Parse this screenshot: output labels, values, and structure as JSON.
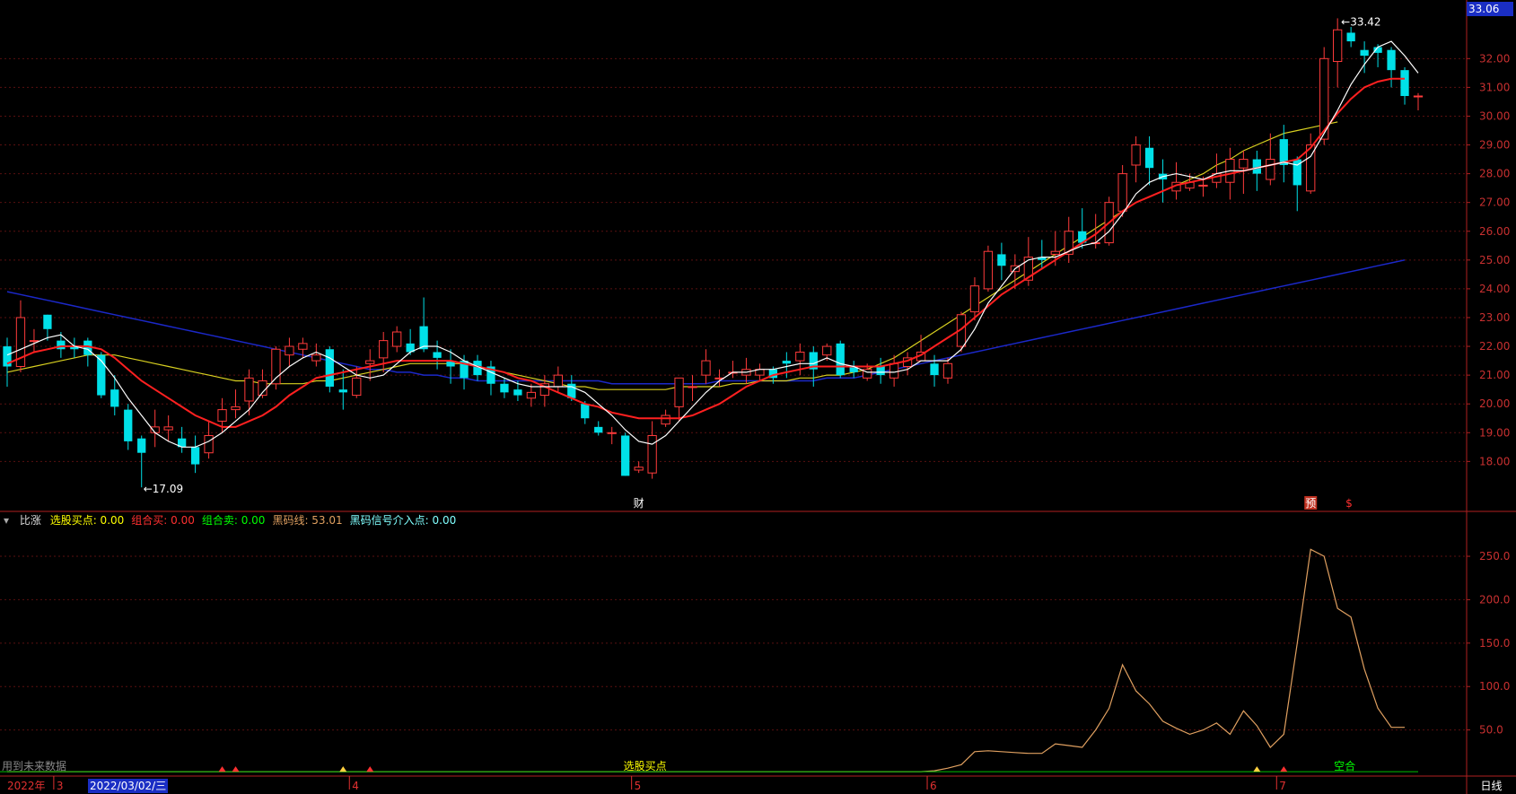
{
  "price_panel": {
    "current_price_tag": "33.06",
    "high_label": "33.42",
    "low_label": "17.09",
    "y_ticks": [
      "32.00",
      "31.00",
      "30.00",
      "29.00",
      "28.00",
      "27.00",
      "26.00",
      "25.00",
      "24.00",
      "23.00",
      "22.00",
      "21.00",
      "20.00",
      "19.00",
      "18.00"
    ],
    "event_labels": [
      {
        "text": "财",
        "color": "#ffffff"
      },
      {
        "text": "预",
        "color": "#ffffff",
        "bg": "#c03020"
      },
      {
        "text": "$",
        "color": "#ff3030"
      }
    ]
  },
  "indicator_panel": {
    "collapse_icon": "chevron-down-icon",
    "name": "比涨",
    "items": [
      {
        "label": "选股买点:",
        "value": "0.00",
        "color": "#ffff00"
      },
      {
        "label": "组合买:",
        "value": "0.00",
        "color": "#ff3030"
      },
      {
        "label": "组合卖:",
        "value": "0.00",
        "color": "#00ff00"
      },
      {
        "label": "黑码线:",
        "value": "53.01",
        "color": "#e0a060"
      },
      {
        "label": "黑码信号介入点:",
        "value": "0.00",
        "color": "#80ffff"
      }
    ],
    "y_ticks": [
      "250.0",
      "200.0",
      "150.0",
      "100.0",
      "50.0"
    ],
    "annotation_buy": "选股买点",
    "annotation_combo": "空合",
    "footer_note": "用到未来数据"
  },
  "date_axis": {
    "year": "2022年",
    "selected_date": "2022/03/02/三",
    "months": [
      "3",
      "4",
      "5",
      "6",
      "7"
    ],
    "period_button": "日线"
  },
  "colors": {
    "up": "#ff3b3b",
    "down": "#00e0e8",
    "ma5": "#ffffff",
    "ma10": "#ff2020",
    "ma20": "#d8d020",
    "ma60": "#1b28c8",
    "black_code_line": "#e0a060",
    "axis": "#b02020"
  },
  "chart_data": {
    "type": "candlestick",
    "y_range": [
      17.2,
      33.6
    ],
    "candles": [
      [
        22.0,
        21.3,
        22.3,
        20.6
      ],
      [
        21.3,
        23.0,
        23.6,
        21.1
      ],
      [
        22.2,
        22.2,
        22.6,
        21.8
      ],
      [
        23.1,
        22.6,
        23.1,
        22.2
      ],
      [
        22.2,
        21.9,
        22.5,
        21.6
      ],
      [
        22.0,
        21.9,
        22.3,
        21.6
      ],
      [
        22.2,
        21.7,
        22.3,
        21.3
      ],
      [
        21.7,
        20.3,
        21.8,
        20.2
      ],
      [
        20.5,
        19.9,
        21.0,
        19.6
      ],
      [
        19.8,
        18.7,
        20.0,
        18.4
      ],
      [
        18.8,
        18.3,
        18.9,
        17.1
      ],
      [
        19.0,
        19.2,
        19.8,
        18.5
      ],
      [
        19.1,
        19.2,
        19.6,
        18.7
      ],
      [
        18.8,
        18.5,
        19.2,
        18.3
      ],
      [
        18.5,
        17.9,
        18.9,
        17.6
      ],
      [
        18.3,
        18.9,
        19.4,
        18.1
      ],
      [
        19.4,
        19.8,
        20.2,
        19.0
      ],
      [
        19.8,
        19.9,
        20.5,
        19.5
      ],
      [
        20.1,
        20.9,
        21.2,
        19.6
      ],
      [
        20.3,
        20.8,
        21.2,
        20.2
      ],
      [
        20.7,
        21.9,
        22.0,
        20.5
      ],
      [
        21.7,
        22.0,
        22.3,
        21.3
      ],
      [
        21.9,
        22.1,
        22.3,
        21.6
      ],
      [
        21.5,
        21.7,
        22.1,
        21.3
      ],
      [
        21.9,
        20.6,
        22.0,
        20.4
      ],
      [
        20.5,
        20.4,
        21.2,
        19.8
      ],
      [
        20.3,
        20.9,
        21.3,
        20.2
      ],
      [
        21.4,
        21.5,
        21.9,
        20.8
      ],
      [
        21.6,
        22.2,
        22.5,
        21.1
      ],
      [
        22.0,
        22.5,
        22.7,
        21.8
      ],
      [
        22.1,
        21.8,
        22.6,
        21.7
      ],
      [
        22.7,
        21.9,
        23.7,
        21.8
      ],
      [
        21.8,
        21.6,
        22.2,
        21.2
      ],
      [
        21.5,
        21.3,
        21.9,
        20.7
      ],
      [
        21.5,
        20.9,
        21.7,
        20.5
      ],
      [
        21.5,
        21.0,
        21.7,
        20.8
      ],
      [
        21.3,
        20.7,
        21.5,
        20.3
      ],
      [
        20.7,
        20.4,
        20.9,
        20.2
      ],
      [
        20.5,
        20.3,
        20.8,
        20.1
      ],
      [
        20.2,
        20.4,
        20.7,
        19.9
      ],
      [
        20.3,
        20.7,
        21.0,
        19.9
      ],
      [
        20.6,
        21.0,
        21.3,
        20.4
      ],
      [
        20.7,
        20.2,
        21.0,
        20.1
      ],
      [
        20.0,
        19.5,
        20.1,
        19.3
      ],
      [
        19.2,
        19.0,
        19.4,
        18.9
      ],
      [
        19.0,
        19.0,
        19.2,
        18.6
      ],
      [
        18.9,
        17.5,
        19.0,
        17.5
      ],
      [
        17.7,
        17.8,
        18.0,
        17.6
      ],
      [
        17.6,
        18.9,
        19.4,
        17.4
      ],
      [
        19.3,
        19.6,
        19.8,
        19.2
      ],
      [
        19.9,
        20.9,
        20.9,
        19.4
      ],
      [
        20.6,
        20.6,
        21.0,
        20.1
      ],
      [
        21.0,
        21.5,
        21.9,
        20.7
      ],
      [
        20.9,
        20.9,
        21.2,
        20.6
      ],
      [
        21.1,
        21.1,
        21.5,
        20.9
      ],
      [
        21.0,
        21.2,
        21.6,
        20.7
      ],
      [
        21.0,
        21.2,
        21.4,
        20.8
      ],
      [
        21.2,
        20.9,
        21.3,
        20.7
      ],
      [
        21.5,
        21.4,
        21.8,
        20.9
      ],
      [
        21.5,
        21.8,
        22.1,
        21.0
      ],
      [
        21.8,
        21.2,
        22.0,
        20.6
      ],
      [
        21.7,
        22.0,
        22.1,
        21.5
      ],
      [
        22.1,
        21.0,
        22.2,
        20.9
      ],
      [
        21.3,
        21.1,
        21.5,
        20.9
      ],
      [
        20.9,
        21.2,
        21.4,
        20.8
      ],
      [
        21.3,
        21.0,
        21.6,
        20.7
      ],
      [
        20.9,
        21.4,
        21.7,
        20.6
      ],
      [
        21.3,
        21.6,
        21.8,
        21.0
      ],
      [
        21.5,
        21.8,
        22.4,
        21.5
      ],
      [
        21.4,
        21.0,
        21.7,
        20.6
      ],
      [
        20.9,
        21.4,
        21.6,
        20.7
      ],
      [
        22.0,
        23.1,
        23.2,
        21.8
      ],
      [
        23.2,
        24.1,
        24.4,
        22.9
      ],
      [
        24.0,
        25.3,
        25.5,
        23.9
      ],
      [
        25.2,
        24.8,
        25.6,
        24.3
      ],
      [
        24.6,
        24.8,
        25.2,
        24.0
      ],
      [
        24.3,
        25.1,
        25.8,
        24.1
      ],
      [
        25.1,
        25.0,
        25.7,
        24.7
      ],
      [
        25.2,
        25.3,
        26.0,
        24.8
      ],
      [
        25.2,
        26.0,
        26.5,
        24.9
      ],
      [
        26.0,
        25.6,
        26.8,
        25.4
      ],
      [
        25.6,
        25.6,
        26.6,
        25.4
      ],
      [
        25.6,
        27.0,
        27.2,
        25.5
      ],
      [
        26.7,
        28.0,
        28.3,
        26.5
      ],
      [
        28.3,
        29.0,
        29.3,
        27.7
      ],
      [
        28.9,
        28.2,
        29.3,
        27.6
      ],
      [
        28.0,
        27.8,
        28.5,
        27.0
      ],
      [
        27.4,
        27.7,
        28.4,
        27.1
      ],
      [
        27.5,
        27.7,
        28.0,
        27.4
      ],
      [
        27.6,
        27.6,
        27.9,
        27.2
      ],
      [
        27.7,
        28.0,
        28.7,
        27.5
      ],
      [
        27.7,
        28.5,
        28.9,
        27.1
      ],
      [
        28.2,
        28.5,
        28.8,
        27.3
      ],
      [
        28.5,
        28.0,
        28.8,
        27.4
      ],
      [
        27.8,
        28.5,
        29.4,
        27.6
      ],
      [
        29.2,
        28.3,
        29.7,
        27.7
      ],
      [
        28.5,
        27.6,
        28.6,
        26.7
      ],
      [
        27.4,
        29.0,
        29.4,
        27.3
      ],
      [
        29.2,
        32.0,
        32.4,
        29.0
      ],
      [
        31.9,
        33.0,
        33.4,
        31.0
      ],
      [
        32.9,
        32.6,
        33.1,
        32.4
      ],
      [
        32.3,
        32.1,
        32.6,
        31.5
      ],
      [
        32.4,
        32.2,
        32.5,
        31.7
      ],
      [
        32.3,
        31.6,
        32.4,
        31.0
      ],
      [
        31.6,
        30.7,
        31.7,
        30.4
      ],
      [
        30.7,
        30.7,
        30.8,
        30.2
      ]
    ],
    "ma5": [
      21.7,
      21.9,
      22.1,
      22.3,
      22.4,
      22.0,
      21.9,
      21.5,
      20.9,
      20.2,
      19.6,
      19.0,
      18.7,
      18.5,
      18.5,
      18.7,
      19.0,
      19.4,
      19.8,
      20.4,
      20.9,
      21.3,
      21.6,
      21.8,
      21.6,
      21.3,
      21.0,
      20.9,
      21.0,
      21.4,
      21.8,
      22.0,
      22.0,
      21.8,
      21.5,
      21.3,
      21.1,
      20.9,
      20.7,
      20.6,
      20.6,
      20.6,
      20.6,
      20.4,
      20.0,
      19.6,
      19.1,
      18.7,
      18.6,
      18.9,
      19.4,
      19.9,
      20.4,
      20.8,
      21.1,
      21.1,
      21.2,
      21.2,
      21.3,
      21.4,
      21.4,
      21.6,
      21.4,
      21.3,
      21.1,
      21.1,
      21.1,
      21.2,
      21.5,
      21.5,
      21.5,
      21.9,
      22.6,
      23.5,
      24.1,
      24.7,
      25.0,
      25.1,
      25.1,
      25.3,
      25.5,
      25.6,
      26.0,
      26.6,
      27.3,
      27.7,
      27.9,
      28.0,
      27.9,
      27.8,
      28.0,
      28.1,
      28.1,
      28.2,
      28.3,
      28.4,
      28.3,
      28.6,
      29.4,
      30.2,
      31.1,
      31.8,
      32.4,
      32.6,
      32.1,
      31.5
    ],
    "ma10": [
      21.4,
      21.6,
      21.8,
      21.9,
      22.0,
      22.0,
      22.0,
      21.9,
      21.6,
      21.2,
      20.8,
      20.5,
      20.2,
      19.9,
      19.6,
      19.4,
      19.2,
      19.2,
      19.4,
      19.6,
      19.9,
      20.3,
      20.6,
      20.9,
      21.0,
      21.1,
      21.2,
      21.3,
      21.4,
      21.5,
      21.5,
      21.5,
      21.5,
      21.5,
      21.4,
      21.3,
      21.2,
      21.1,
      20.9,
      20.8,
      20.6,
      20.4,
      20.2,
      20.0,
      19.9,
      19.7,
      19.6,
      19.5,
      19.5,
      19.5,
      19.5,
      19.6,
      19.8,
      20.0,
      20.3,
      20.6,
      20.8,
      21.0,
      21.1,
      21.2,
      21.3,
      21.3,
      21.3,
      21.3,
      21.3,
      21.3,
      21.4,
      21.5,
      21.7,
      22.0,
      22.3,
      22.6,
      23.0,
      23.4,
      23.8,
      24.1,
      24.4,
      24.7,
      25.0,
      25.3,
      25.6,
      25.9,
      26.3,
      26.7,
      27.0,
      27.2,
      27.4,
      27.6,
      27.7,
      27.8,
      27.9,
      28.0,
      28.1,
      28.2,
      28.3,
      28.4,
      28.5,
      28.9,
      29.5,
      30.1,
      30.6,
      31.0,
      31.2,
      31.3,
      31.3
    ],
    "ma20": [
      21.1,
      21.2,
      21.3,
      21.4,
      21.5,
      21.6,
      21.7,
      21.7,
      21.7,
      21.6,
      21.5,
      21.4,
      21.3,
      21.2,
      21.1,
      21.0,
      20.9,
      20.8,
      20.8,
      20.7,
      20.7,
      20.7,
      20.7,
      20.8,
      20.8,
      20.9,
      21.0,
      21.1,
      21.2,
      21.3,
      21.4,
      21.4,
      21.4,
      21.4,
      21.4,
      21.3,
      21.2,
      21.1,
      21.0,
      20.9,
      20.8,
      20.7,
      20.6,
      20.6,
      20.5,
      20.5,
      20.5,
      20.5,
      20.5,
      20.5,
      20.6,
      20.6,
      20.6,
      20.6,
      20.7,
      20.7,
      20.8,
      20.8,
      20.8,
      20.9,
      20.9,
      21.0,
      21.0,
      21.1,
      21.2,
      21.4,
      21.6,
      21.9,
      22.2,
      22.5,
      22.8,
      23.1,
      23.4,
      23.7,
      24.0,
      24.3,
      24.6,
      24.9,
      25.2,
      25.5,
      25.8,
      26.1,
      26.4,
      26.7,
      27.0,
      27.2,
      27.4,
      27.6,
      27.8,
      28.0,
      28.3,
      28.5,
      28.8,
      29.0,
      29.2,
      29.4,
      29.5,
      29.6,
      29.7,
      29.8
    ],
    "ma60": [
      23.9,
      23.8,
      23.7,
      23.6,
      23.5,
      23.4,
      23.3,
      23.2,
      23.1,
      23.0,
      22.9,
      22.8,
      22.7,
      22.6,
      22.5,
      22.4,
      22.3,
      22.2,
      22.1,
      22.0,
      21.9,
      21.8,
      21.7,
      21.6,
      21.5,
      21.4,
      21.3,
      21.2,
      21.2,
      21.1,
      21.1,
      21.0,
      21.0,
      20.9,
      20.9,
      20.8,
      20.8,
      20.8,
      20.8,
      20.8,
      20.8,
      20.8,
      20.8,
      20.8,
      20.8,
      20.7,
      20.7,
      20.7,
      20.7,
      20.7,
      20.7,
      20.7,
      20.7,
      20.8,
      20.8,
      20.8,
      20.8,
      20.8,
      20.8,
      20.8,
      20.8,
      20.9,
      20.9,
      20.9,
      21.0,
      21.1,
      21.2,
      21.3,
      21.4,
      21.5,
      21.6,
      21.7,
      21.8,
      21.9,
      22.0,
      22.1,
      22.2,
      22.3,
      22.4,
      22.5,
      22.6,
      22.7,
      22.8,
      22.9,
      23.0,
      23.1,
      23.2,
      23.3,
      23.4,
      23.5,
      23.6,
      23.7,
      23.8,
      23.9,
      24.0,
      24.1,
      24.2,
      24.3,
      24.4,
      24.5,
      24.6,
      24.7,
      24.8,
      24.9,
      25.0
    ],
    "black_code_line": [
      2,
      2,
      2,
      2,
      2,
      2,
      2,
      2,
      2,
      2,
      2,
      2,
      2,
      2,
      2,
      2,
      2,
      2,
      2,
      2,
      2,
      2,
      2,
      2,
      2,
      2,
      2,
      2,
      2,
      2,
      2,
      2,
      2,
      2,
      2,
      2,
      2,
      2,
      2,
      2,
      2,
      2,
      2,
      2,
      2,
      2,
      2,
      2,
      2,
      2,
      2,
      2,
      2,
      2,
      2,
      2,
      2,
      2,
      2,
      2,
      2,
      2,
      2,
      2,
      2,
      2,
      2,
      2,
      2,
      3,
      6,
      10,
      25,
      26,
      25,
      24,
      23,
      23,
      34,
      32,
      30,
      50,
      75,
      125,
      95,
      80,
      60,
      52,
      45,
      50,
      58,
      45,
      72,
      55,
      30,
      45,
      150,
      258,
      250,
      190,
      180,
      120,
      75,
      53,
      53
    ],
    "ind_range": [
      0,
      280
    ]
  }
}
